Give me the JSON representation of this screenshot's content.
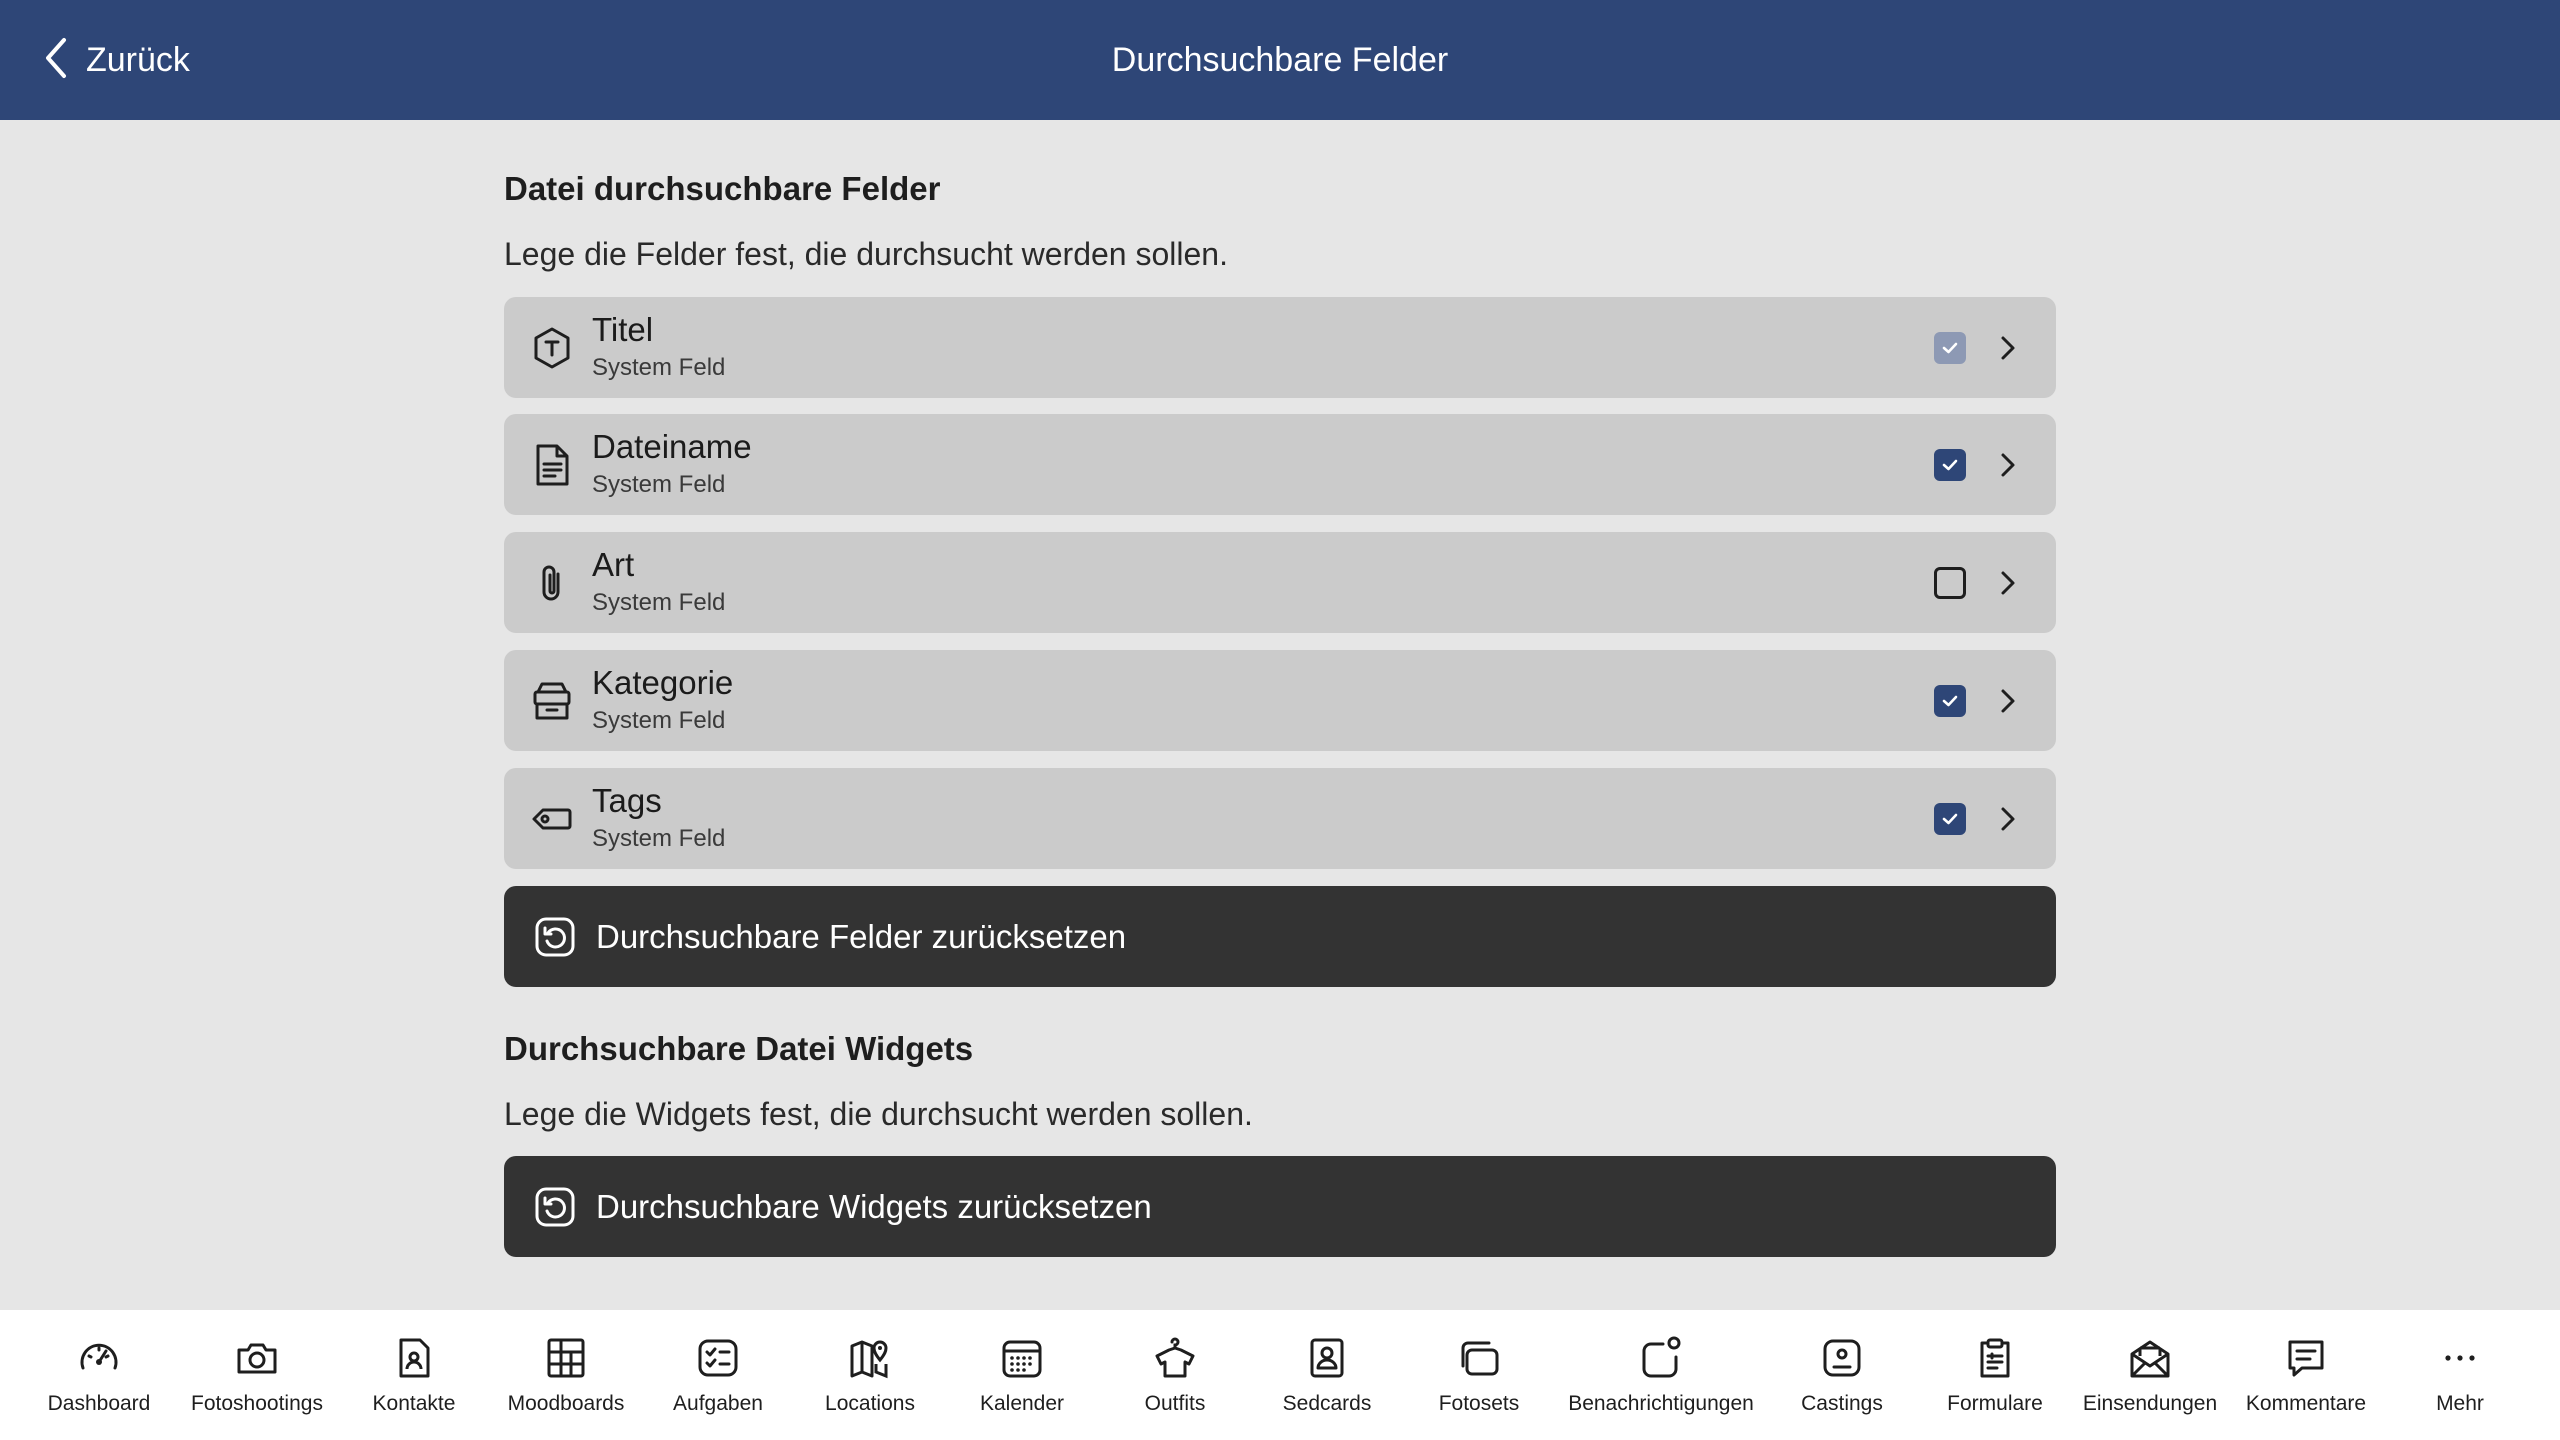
{
  "header": {
    "back_label": "Zurück",
    "title": "Durchsuchbare Felder",
    "background": "#2e4677"
  },
  "fields_section": {
    "title": "Datei durchsuchbare Felder",
    "description": "Lege die Felder fest, die durchsucht werden sollen.",
    "items": [
      {
        "name": "Titel",
        "subtitle": "System Feld",
        "icon": "title-hexagon-icon",
        "state": "checked-disabled"
      },
      {
        "name": "Dateiname",
        "subtitle": "System Feld",
        "icon": "document-icon",
        "state": "checked"
      },
      {
        "name": "Art",
        "subtitle": "System Feld",
        "icon": "paperclip-icon",
        "state": "unchecked"
      },
      {
        "name": "Kategorie",
        "subtitle": "System Feld",
        "icon": "archive-box-icon",
        "state": "checked"
      },
      {
        "name": "Tags",
        "subtitle": "System Feld",
        "icon": "tag-icon",
        "state": "checked"
      }
    ],
    "reset_label": "Durchsuchbare Felder zurücksetzen"
  },
  "widgets_section": {
    "title": "Durchsuchbare Datei Widgets",
    "description": "Lege die Widgets fest, die durchsucht werden sollen.",
    "reset_label": "Durchsuchbare Widgets zurücksetzen"
  },
  "tabbar": {
    "items": [
      {
        "label": "Dashboard",
        "icon": "speedometer-icon"
      },
      {
        "label": "Fotoshootings",
        "icon": "camera-icon"
      },
      {
        "label": "Kontakte",
        "icon": "contact-card-icon"
      },
      {
        "label": "Moodboards",
        "icon": "moodboard-grid-icon"
      },
      {
        "label": "Aufgaben",
        "icon": "task-list-icon"
      },
      {
        "label": "Locations",
        "icon": "map-pin-icon"
      },
      {
        "label": "Kalender",
        "icon": "calendar-icon"
      },
      {
        "label": "Outfits",
        "icon": "hanger-shirt-icon"
      },
      {
        "label": "Sedcards",
        "icon": "profile-card-icon"
      },
      {
        "label": "Fotosets",
        "icon": "photo-stack-icon"
      },
      {
        "label": "Benachrichtigungen",
        "icon": "notification-icon"
      },
      {
        "label": "Castings",
        "icon": "casting-badge-icon"
      },
      {
        "label": "Formulare",
        "icon": "clipboard-form-icon"
      },
      {
        "label": "Einsendungen",
        "icon": "envelope-open-icon"
      },
      {
        "label": "Kommentare",
        "icon": "comment-icon"
      },
      {
        "label": "Mehr",
        "icon": "more-dots-icon"
      }
    ]
  },
  "colors": {
    "accent": "#2e4677",
    "background": "#e6e6e6",
    "row": "#cbcbcb",
    "button_dark": "#333333"
  }
}
